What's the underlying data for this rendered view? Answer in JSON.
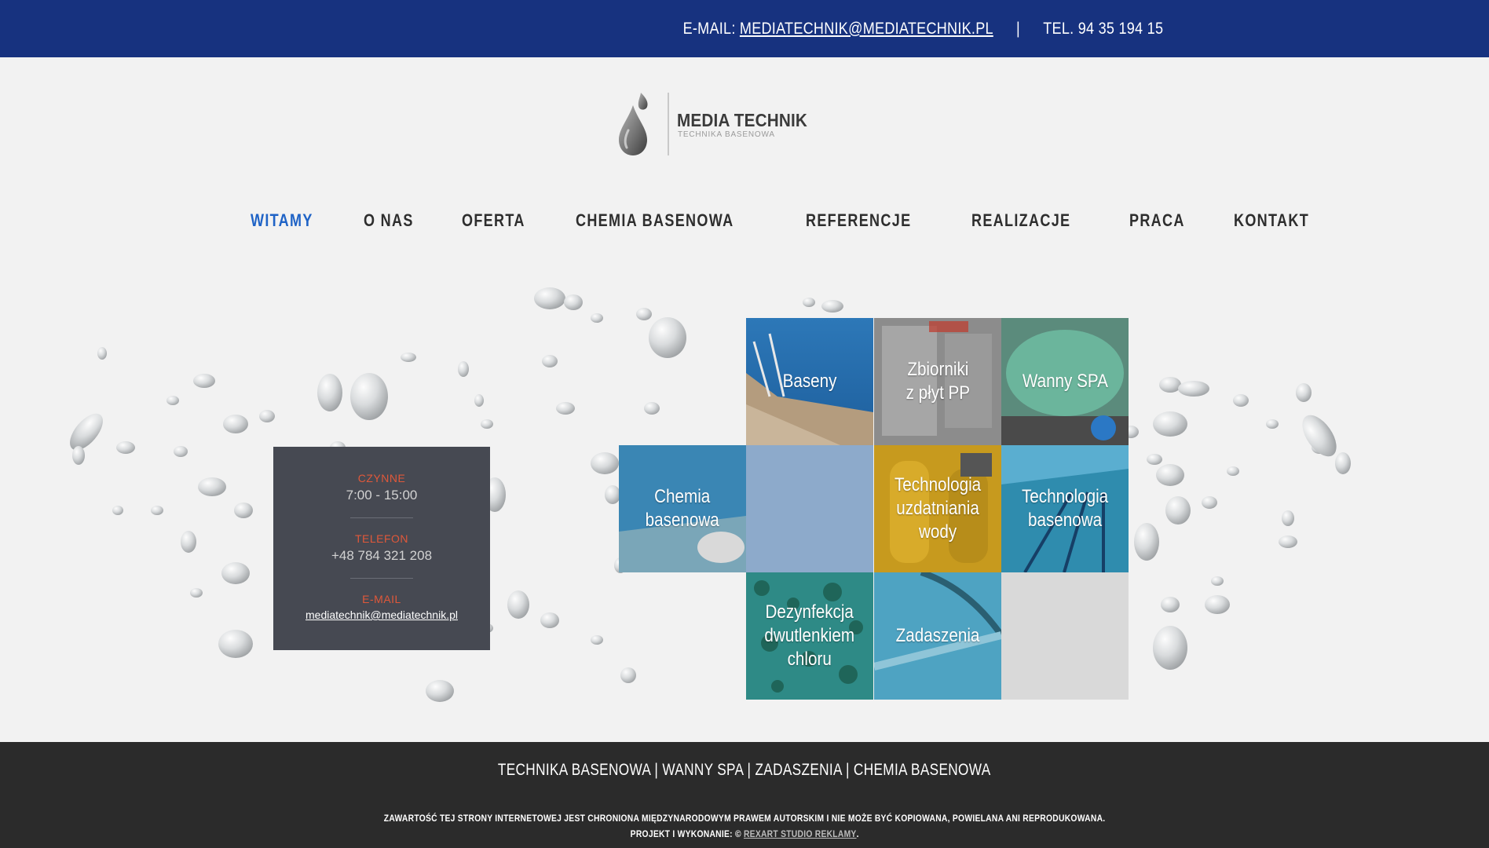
{
  "topbar": {
    "email_label": "E-MAIL:",
    "email": "MEDIATECHNIK@MEDIATECHNIK.PL",
    "separator": "|",
    "phone": "TEL. 94 35 194 15"
  },
  "logo": {
    "name": "MEDIA TECHNIK",
    "tagline": "TECHNIKA BASENOWA",
    "icon": "water-drop-icon"
  },
  "nav": {
    "items": [
      {
        "label": "WITAMY",
        "active": true
      },
      {
        "label": "O NAS"
      },
      {
        "label": "OFERTA"
      },
      {
        "label": "CHEMIA BASENOWA"
      },
      {
        "label": "REFERENCJE"
      },
      {
        "label": "REALIZACJE"
      },
      {
        "label": "PRACA"
      },
      {
        "label": "KONTAKT"
      }
    ]
  },
  "info": {
    "hours_label": "CZYNNE",
    "hours_value": "7:00 - 15:00",
    "phone_label": "TELEFON",
    "phone_value": "+48 784 321 208",
    "email_label": "E-MAIL",
    "email_value": "mediatechnik@mediatechnik.pl"
  },
  "tiles": {
    "baseny": "Baseny",
    "zbiorniki_1": "Zbiorniki",
    "zbiorniki_2": "z płyt PP",
    "spa": "Wanny SPA",
    "chemia_1": "Chemia",
    "chemia_2": "basenowa",
    "uzdat_1": "Technologia",
    "uzdat_2": "uzdatniania",
    "uzdat_3": "wody",
    "techbas_1": "Technologia",
    "techbas_2": "basenowa",
    "dez_1": "Dezynfekcja",
    "dez_2": "dwutlenkiem",
    "dez_3": "chloru",
    "zadaszenia": "Zadaszenia"
  },
  "colors": {
    "topbar": "#17327f",
    "accent": "#1f63c6",
    "info_label": "#e0583a",
    "footer": "#2b2b2b"
  },
  "footer": {
    "links": "TECHNIKA BASENOWA | WANNY SPA | ZADASZENIA | CHEMIA BASENOWA",
    "copyright": "ZAWARTOŚĆ TEJ STRONY INTERNETOWEJ JEST CHRONIONA MIĘDZYNARODOWYM PRAWEM AUTORSKIM I NIE MOŻE BYĆ KOPIOWANA, POWIELANA ANI REPRODUKOWANA.",
    "credit_prefix": "PROJEKT I WYKONANIE: ©",
    "credit_link": "REXART STUDIO REKLAMY",
    "credit_suffix": "."
  }
}
